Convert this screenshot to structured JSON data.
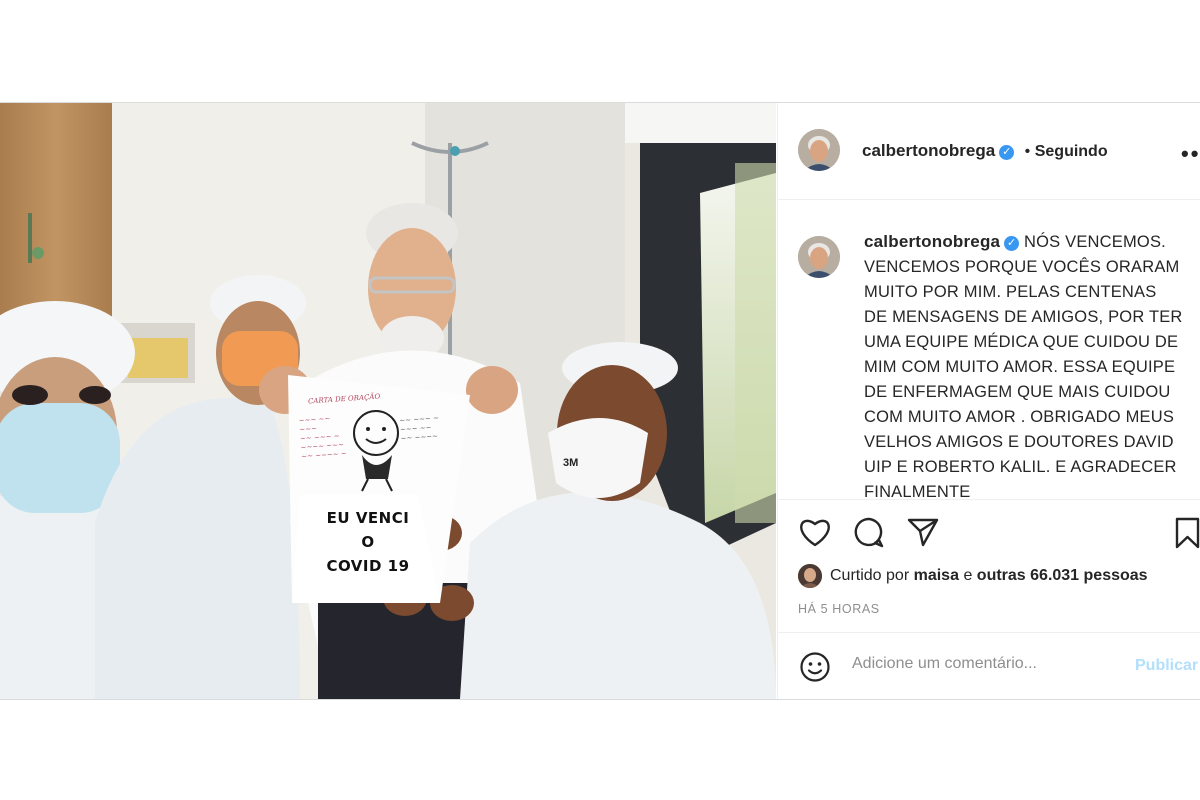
{
  "post": {
    "author": {
      "username": "calbertonobrega",
      "verified": true,
      "follow_separator": "•",
      "follow_status": "Seguindo"
    },
    "more_icon": "more-dots-icon",
    "caption": {
      "username": "calbertonobrega",
      "text": "NÓS VENCEMOS. VENCEMOS PORQUE VOCÊS ORARAM MUITO POR MIM. PELAS CENTENAS DE MENSAGENS DE AMIGOS, POR TER UMA EQUIPE MÉDICA QUE CUIDOU DE MIM COM MUITO AMOR. ESSA EQUIPE DE ENFERMAGEM QUE MAIS CUIDOU COM MUITO AMOR . OBRIGADO MEUS VELHOS AMIGOS E DOUTORES DAVID UIP E ROBERTO KALIL. E AGRADECER FINALMENTE"
    },
    "photo": {
      "sign_line1": "EU VENCI",
      "sign_line2": "O",
      "sign_line3": "COVID 19",
      "sign_header": "CARTA DE ORAÇÃO",
      "mask_brand": "3M"
    },
    "actions": {
      "like_icon": "heart-icon",
      "comment_icon": "comment-icon",
      "share_icon": "share-icon",
      "save_icon": "bookmark-icon"
    },
    "likes": {
      "prefix": "Curtido por",
      "user": "maisa",
      "conj": "e",
      "others": "outras 66.031 pessoas"
    },
    "timestamp": "HÁ 5 HORAS",
    "comment": {
      "placeholder": "Adicione um comentário...",
      "publish_label": "Publicar",
      "emoji_icon": "emoji-smile-icon"
    }
  },
  "colors": {
    "verified": "#3897f0",
    "publish_disabled": "#b2dffc",
    "muted_text": "#8e8e8e",
    "border": "#dbdbdb"
  }
}
